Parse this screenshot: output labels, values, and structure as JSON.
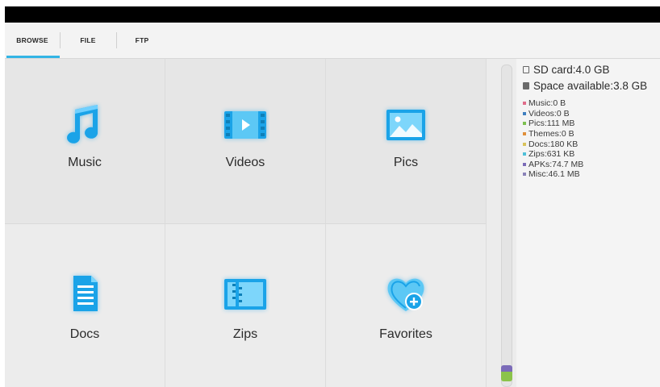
{
  "tabs": [
    {
      "label": "BROWSE",
      "active": true
    },
    {
      "label": "FILE",
      "active": false
    },
    {
      "label": "FTP",
      "active": false
    }
  ],
  "categories": [
    {
      "label": "Music",
      "icon": "music-icon"
    },
    {
      "label": "Videos",
      "icon": "video-icon"
    },
    {
      "label": "Pics",
      "icon": "picture-icon"
    },
    {
      "label": "Docs",
      "icon": "document-icon"
    },
    {
      "label": "Zips",
      "icon": "zip-icon"
    },
    {
      "label": "Favorites",
      "icon": "favorites-icon"
    }
  ],
  "storage": {
    "sd_card": "SD card:4.0 GB",
    "space_available": "Space available:3.8 GB",
    "breakdown": [
      {
        "label": "Music:0 B",
        "color": "#e06c8a"
      },
      {
        "label": "Videos:0 B",
        "color": "#3f7fc0"
      },
      {
        "label": "Pics:111 MB",
        "color": "#7cc04f"
      },
      {
        "label": "Themes:0 B",
        "color": "#e08f3a"
      },
      {
        "label": "Docs:180 KB",
        "color": "#d8c25a"
      },
      {
        "label": "Zips:631 KB",
        "color": "#4fc0d8"
      },
      {
        "label": "APKs:74.7 MB",
        "color": "#7b6bb8"
      },
      {
        "label": "Misc:46.1 MB",
        "color": "#8a82b8"
      }
    ]
  },
  "colors": {
    "accent": "#33b5e5",
    "icon_blue": "#1aa3e8"
  }
}
